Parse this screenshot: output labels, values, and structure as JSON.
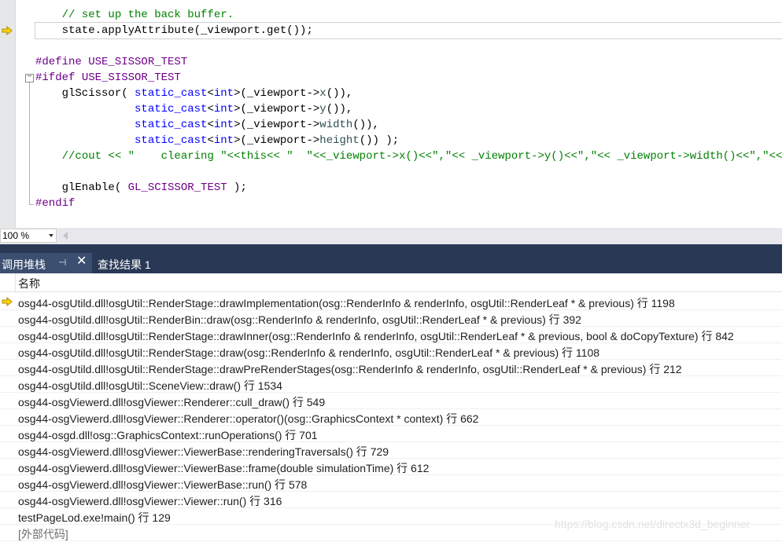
{
  "editor": {
    "lines": [
      [
        {
          "t": "    ",
          "c": "tk-ident"
        },
        {
          "t": "// set up the back buffer.",
          "c": "tk-comment"
        }
      ],
      [
        {
          "t": "    state.applyAttribute(_viewport.get());",
          "c": "tk-ident"
        }
      ],
      [
        {
          "t": "",
          "c": "tk-ident"
        }
      ],
      [
        {
          "t": "#define ",
          "c": "tk-pp"
        },
        {
          "t": "USE_SISSOR_TEST",
          "c": "tk-macro"
        }
      ],
      [
        {
          "t": "#ifdef ",
          "c": "tk-pp"
        },
        {
          "t": "USE_SISSOR_TEST",
          "c": "tk-macro"
        }
      ],
      [
        {
          "t": "    glScissor( ",
          "c": "tk-ident"
        },
        {
          "t": "static_cast",
          "c": "tk-kw"
        },
        {
          "t": "<",
          "c": "tk-ident"
        },
        {
          "t": "int",
          "c": "tk-kw"
        },
        {
          "t": ">(_viewport->",
          "c": "tk-ident"
        },
        {
          "t": "x",
          "c": "tk-member"
        },
        {
          "t": "()),",
          "c": "tk-ident"
        }
      ],
      [
        {
          "t": "               ",
          "c": "tk-ident"
        },
        {
          "t": "static_cast",
          "c": "tk-kw"
        },
        {
          "t": "<",
          "c": "tk-ident"
        },
        {
          "t": "int",
          "c": "tk-kw"
        },
        {
          "t": ">(_viewport->",
          "c": "tk-ident"
        },
        {
          "t": "y",
          "c": "tk-member"
        },
        {
          "t": "()),",
          "c": "tk-ident"
        }
      ],
      [
        {
          "t": "               ",
          "c": "tk-ident"
        },
        {
          "t": "static_cast",
          "c": "tk-kw"
        },
        {
          "t": "<",
          "c": "tk-ident"
        },
        {
          "t": "int",
          "c": "tk-kw"
        },
        {
          "t": ">(_viewport->",
          "c": "tk-ident"
        },
        {
          "t": "width",
          "c": "tk-member"
        },
        {
          "t": "()),",
          "c": "tk-ident"
        }
      ],
      [
        {
          "t": "               ",
          "c": "tk-ident"
        },
        {
          "t": "static_cast",
          "c": "tk-kw"
        },
        {
          "t": "<",
          "c": "tk-ident"
        },
        {
          "t": "int",
          "c": "tk-kw"
        },
        {
          "t": ">(_viewport->",
          "c": "tk-ident"
        },
        {
          "t": "height",
          "c": "tk-member"
        },
        {
          "t": "()) );",
          "c": "tk-ident"
        }
      ],
      [
        {
          "t": "    ",
          "c": "tk-ident"
        },
        {
          "t": "//cout << \"    clearing \"<<this<< \"  \"<<_viewport->x()<<\",\"<< _viewport->y()<<\",\"<< _viewport->width()<<\",\"<< _viewport->",
          "c": "tk-comment"
        }
      ],
      [
        {
          "t": "",
          "c": "tk-ident"
        }
      ],
      [
        {
          "t": "    glEnable( ",
          "c": "tk-ident"
        },
        {
          "t": "GL_SCISSOR_TEST",
          "c": "tk-macro"
        },
        {
          "t": " );",
          "c": "tk-ident"
        }
      ],
      [
        {
          "t": "#endif",
          "c": "tk-pp"
        }
      ]
    ],
    "current_line_index": 1,
    "fold_marker": "−"
  },
  "zoom": {
    "value": "100 %"
  },
  "tabs": {
    "callstack_label": "调用堆栈",
    "pin_glyph": "⊣",
    "close_glyph": "✕",
    "find_label": "查找结果 1"
  },
  "callstack": {
    "column_header": "名称",
    "current_frame_index": 0,
    "frames": [
      "osg44-osgUtild.dll!osgUtil::RenderStage::drawImplementation(osg::RenderInfo & renderInfo, osgUtil::RenderLeaf * & previous) 行 1198",
      "osg44-osgUtild.dll!osgUtil::RenderBin::draw(osg::RenderInfo & renderInfo, osgUtil::RenderLeaf * & previous) 行 392",
      "osg44-osgUtild.dll!osgUtil::RenderStage::drawInner(osg::RenderInfo & renderInfo, osgUtil::RenderLeaf * & previous, bool & doCopyTexture) 行 842",
      "osg44-osgUtild.dll!osgUtil::RenderStage::draw(osg::RenderInfo & renderInfo, osgUtil::RenderLeaf * & previous) 行 1108",
      "osg44-osgUtild.dll!osgUtil::RenderStage::drawPreRenderStages(osg::RenderInfo & renderInfo, osgUtil::RenderLeaf * & previous) 行 212",
      "osg44-osgUtild.dll!osgUtil::SceneView::draw() 行 1534",
      "osg44-osgViewerd.dll!osgViewer::Renderer::cull_draw() 行 549",
      "osg44-osgViewerd.dll!osgViewer::Renderer::operator()(osg::GraphicsContext * context) 行 662",
      "osg44-osgd.dll!osg::GraphicsContext::runOperations() 行 701",
      "osg44-osgViewerd.dll!osgViewer::ViewerBase::renderingTraversals() 行 729",
      "osg44-osgViewerd.dll!osgViewer::ViewerBase::frame(double simulationTime) 行 612",
      "osg44-osgViewerd.dll!osgViewer::ViewerBase::run() 行 578",
      "osg44-osgViewerd.dll!osgViewer::Viewer::run() 行 316",
      "testPageLod.exe!main() 行 129",
      "[外部代码]"
    ]
  },
  "watermark": "https://blog.csdn.net/directx3d_beginner",
  "colors": {
    "arrow_fill": "#ffd800",
    "arrow_stroke": "#b08800",
    "tab_background": "#293955",
    "active_tab": "#3c4f70"
  }
}
